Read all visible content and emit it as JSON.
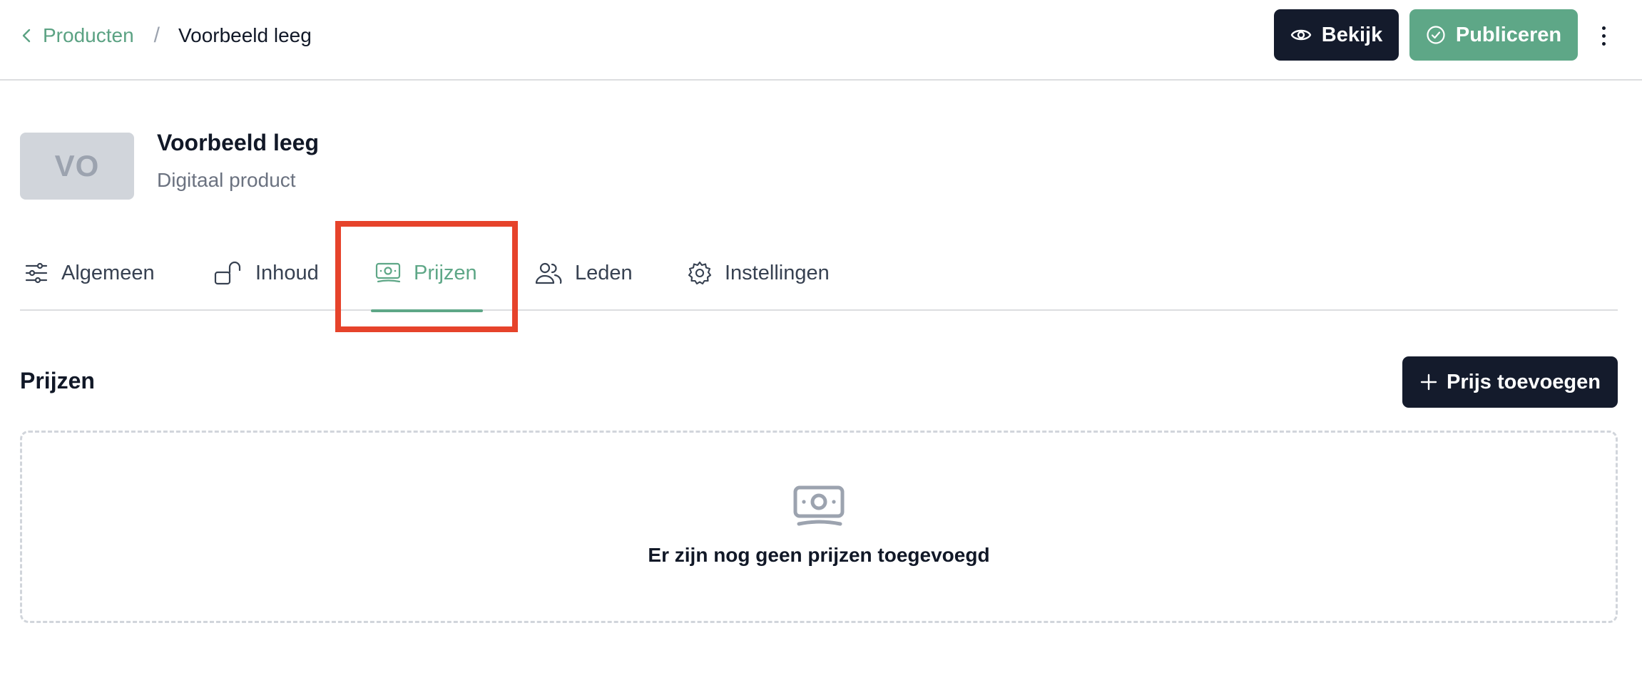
{
  "breadcrumb": {
    "back_label": "Producten",
    "separator": "/",
    "current": "Voorbeeld leeg"
  },
  "header_actions": {
    "view_label": "Bekijk",
    "publish_label": "Publiceren",
    "more_icon": "kebab-vertical-icon"
  },
  "product": {
    "initials": "VO",
    "title": "Voorbeeld leeg",
    "subtitle": "Digitaal product"
  },
  "tabs": [
    {
      "label": "Algemeen",
      "icon": "sliders-icon",
      "active": false
    },
    {
      "label": "Inhoud",
      "icon": "unlock-icon",
      "active": false
    },
    {
      "label": "Prijzen",
      "icon": "banknote-icon",
      "active": true
    },
    {
      "label": "Leden",
      "icon": "users-icon",
      "active": false
    },
    {
      "label": "Instellingen",
      "icon": "gear-icon",
      "active": false
    }
  ],
  "section": {
    "title": "Prijzen",
    "add_label": "Prijs toevoegen",
    "empty_message": "Er zijn nog geen prijzen toegevoegd"
  },
  "colors": {
    "accent": "#5ea787",
    "dark": "#141b2c",
    "highlight": "#e6432b",
    "muted": "#6b7280"
  }
}
